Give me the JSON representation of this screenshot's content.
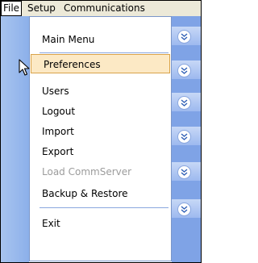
{
  "menubar": {
    "file": "File",
    "setup": "Setup",
    "communications": "Communications"
  },
  "menu": {
    "items": [
      {
        "label": "Main Menu"
      },
      {
        "label": "Preferences"
      },
      {
        "label": "Users"
      },
      {
        "label": "Logout"
      },
      {
        "label": "Import"
      },
      {
        "label": "Export"
      },
      {
        "label": "Load CommServer"
      },
      {
        "label": "Backup & Restore"
      },
      {
        "label": "Exit"
      }
    ]
  },
  "colors": {
    "highlight_bg": "#fce9c5",
    "highlight_border": "#d9a34a",
    "strip_blue": "#8cb0ea",
    "disabled_text": "#9c9c9c"
  },
  "icons": [
    "chevron-down-icon",
    "mouse-pointer-icon"
  ]
}
